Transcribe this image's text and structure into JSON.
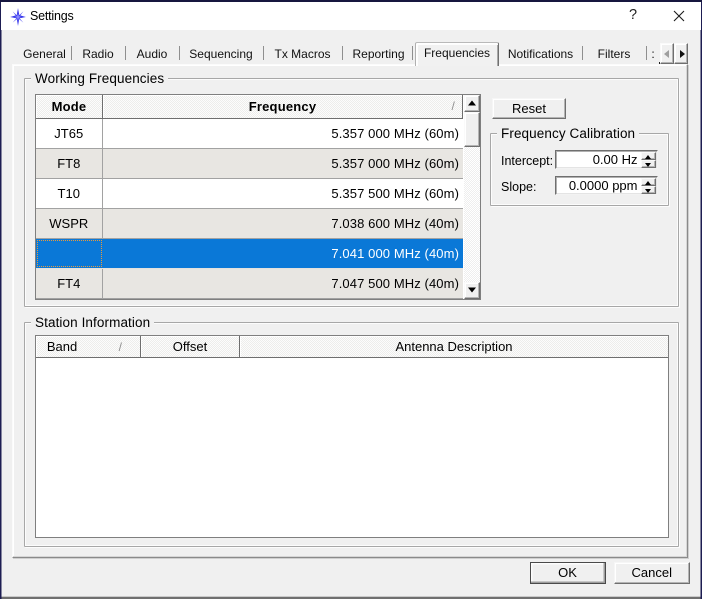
{
  "window": {
    "title": "Settings",
    "help_button": "?",
    "close_icon": "x"
  },
  "tabs": {
    "items": [
      {
        "label": "General",
        "selected": false
      },
      {
        "label": "Radio",
        "selected": false
      },
      {
        "label": "Audio",
        "selected": false
      },
      {
        "label": "Sequencing",
        "selected": false
      },
      {
        "label": "Tx Macros",
        "selected": false
      },
      {
        "label": "Reporting",
        "selected": false
      },
      {
        "label": "Frequencies",
        "selected": true
      },
      {
        "label": "Notifications",
        "selected": false
      },
      {
        "label": "Filters",
        "selected": false
      },
      {
        "label": ":",
        "selected": false,
        "clipped": true
      }
    ],
    "scroll_left_enabled": false,
    "scroll_right_enabled": true
  },
  "working_frequencies": {
    "group_label": "Working Frequencies",
    "reset_button": "Reset",
    "table": {
      "columns": [
        "Mode",
        "Frequency"
      ],
      "sort_indicator": "/",
      "sort_column": "Frequency",
      "rows": [
        {
          "mode": "JT65",
          "frequency": "5.357 000 MHz (60m)",
          "selected": false
        },
        {
          "mode": "FT8",
          "frequency": "5.357 000 MHz (60m)",
          "selected": false
        },
        {
          "mode": "T10",
          "frequency": "5.357 500 MHz (60m)",
          "selected": false
        },
        {
          "mode": "WSPR",
          "frequency": "7.038 600 MHz (40m)",
          "selected": false
        },
        {
          "mode": "",
          "frequency": "7.041 000 MHz (40m)",
          "selected": true
        },
        {
          "mode": "FT4",
          "frequency": "7.047 500 MHz (40m)",
          "selected": false
        }
      ]
    }
  },
  "frequency_calibration": {
    "group_label": "Frequency Calibration",
    "intercept_label": "Intercept:",
    "intercept_value": "0.00 Hz",
    "slope_label": "Slope:",
    "slope_value": "0.0000 ppm"
  },
  "station_information": {
    "group_label": "Station Information",
    "table": {
      "columns": [
        "Band",
        "Offset",
        "Antenna Description"
      ],
      "sort_indicator": "/",
      "sort_column": "Band",
      "rows": []
    }
  },
  "footer": {
    "ok_button": "OK",
    "cancel_button": "Cancel"
  },
  "colors": {
    "selection_blue": "#0a78d7",
    "alternate_row": "#e8e6e2",
    "dialog_background": "#f0f0f0",
    "focus_dots": "#e89a3c"
  }
}
